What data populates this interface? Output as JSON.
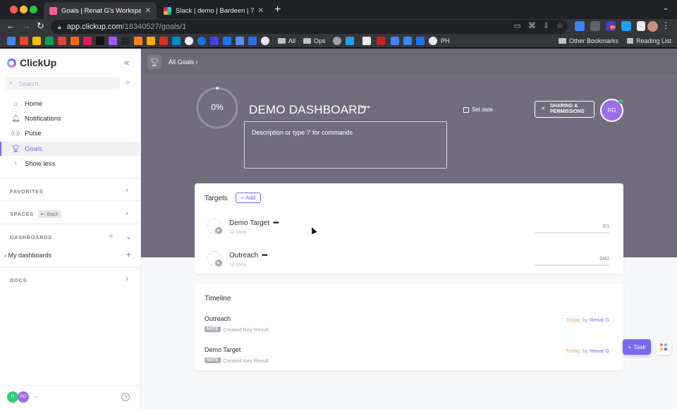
{
  "browser": {
    "tabs": [
      {
        "title": "Goals | Renat G's Workspace",
        "close": "✕",
        "favicon_color": "#fd5f91"
      },
      {
        "title": "Slack | demo | Bardeen | 7 new",
        "close": "✕",
        "favicon_color": "#e01e5a"
      }
    ],
    "newtab_symbol": "+",
    "menu_symbol": "⌄",
    "url_host": "app.clickup.com",
    "url_path": "/18340527/goals/1",
    "bookmarks": [
      {
        "label": "All"
      },
      {
        "label": "Ops"
      },
      {
        "label": "PH"
      },
      {
        "label": "Other Bookmarks"
      },
      {
        "label": "Reading List"
      }
    ],
    "ext_badge": "8+"
  },
  "sidebar": {
    "logo_text": "ClickUp",
    "collapse_symbol": "«",
    "search_placeholder": "Search",
    "nav": [
      {
        "label": "Home",
        "icon": "⌂"
      },
      {
        "label": "Notifications",
        "icon": "🔔︎"
      },
      {
        "label": "Pulse",
        "icon": "((·))"
      },
      {
        "label": "Goals",
        "icon": "🏆︎"
      },
      {
        "label": "Show less",
        "icon": "↑"
      }
    ],
    "sections": {
      "favorites": "FAVORITES",
      "spaces": "SPACES",
      "spaces_badge": "⇤ Back",
      "dashboards": "DASHBOARDS",
      "docs": "DOCS"
    },
    "my_dashboards": "› My dashboards",
    "user_initials": [
      "R",
      "RG"
    ],
    "help_symbol": "?"
  },
  "topbar": {
    "breadcrumb": "All Goals  ›"
  },
  "goal": {
    "progress_text": "0%",
    "progress": 0.0,
    "title": "DEMO DASHBOARD",
    "more_symbol": "•••",
    "set_date": "Set date",
    "share_line1": "SHARING &",
    "share_line2": "PERMISSIONS",
    "owner_initials": "RG",
    "description_placeholder": "Description or type '/' for commands"
  },
  "targets": {
    "heading": "Targets",
    "add_label": "+ Add",
    "items": [
      {
        "name": "Demo Target",
        "dots": "•••",
        "subtitle": "12 mins",
        "count": "0/1",
        "progress": 0.0
      },
      {
        "name": "Outreach",
        "dots": "•••",
        "subtitle": "12 mins",
        "count": "0/42",
        "progress": 0.0
      }
    ]
  },
  "timeline": {
    "heading": "Timeline",
    "items": [
      {
        "name": "Outreach",
        "note": "NOTE",
        "action": "Created Key Result",
        "when": "Today",
        "by": ", by ",
        "user": "Renat G"
      },
      {
        "name": "Demo Target",
        "note": "NOTE",
        "action": "Created Key Result",
        "when": "Today",
        "by": ", by ",
        "user": "Renat G"
      }
    ]
  },
  "fab": {
    "task_label": "Task",
    "task_icon": "+"
  },
  "colors": {
    "accent": "#7b68ee",
    "hero_bg": "#716d7e",
    "today": "#f0a268"
  }
}
